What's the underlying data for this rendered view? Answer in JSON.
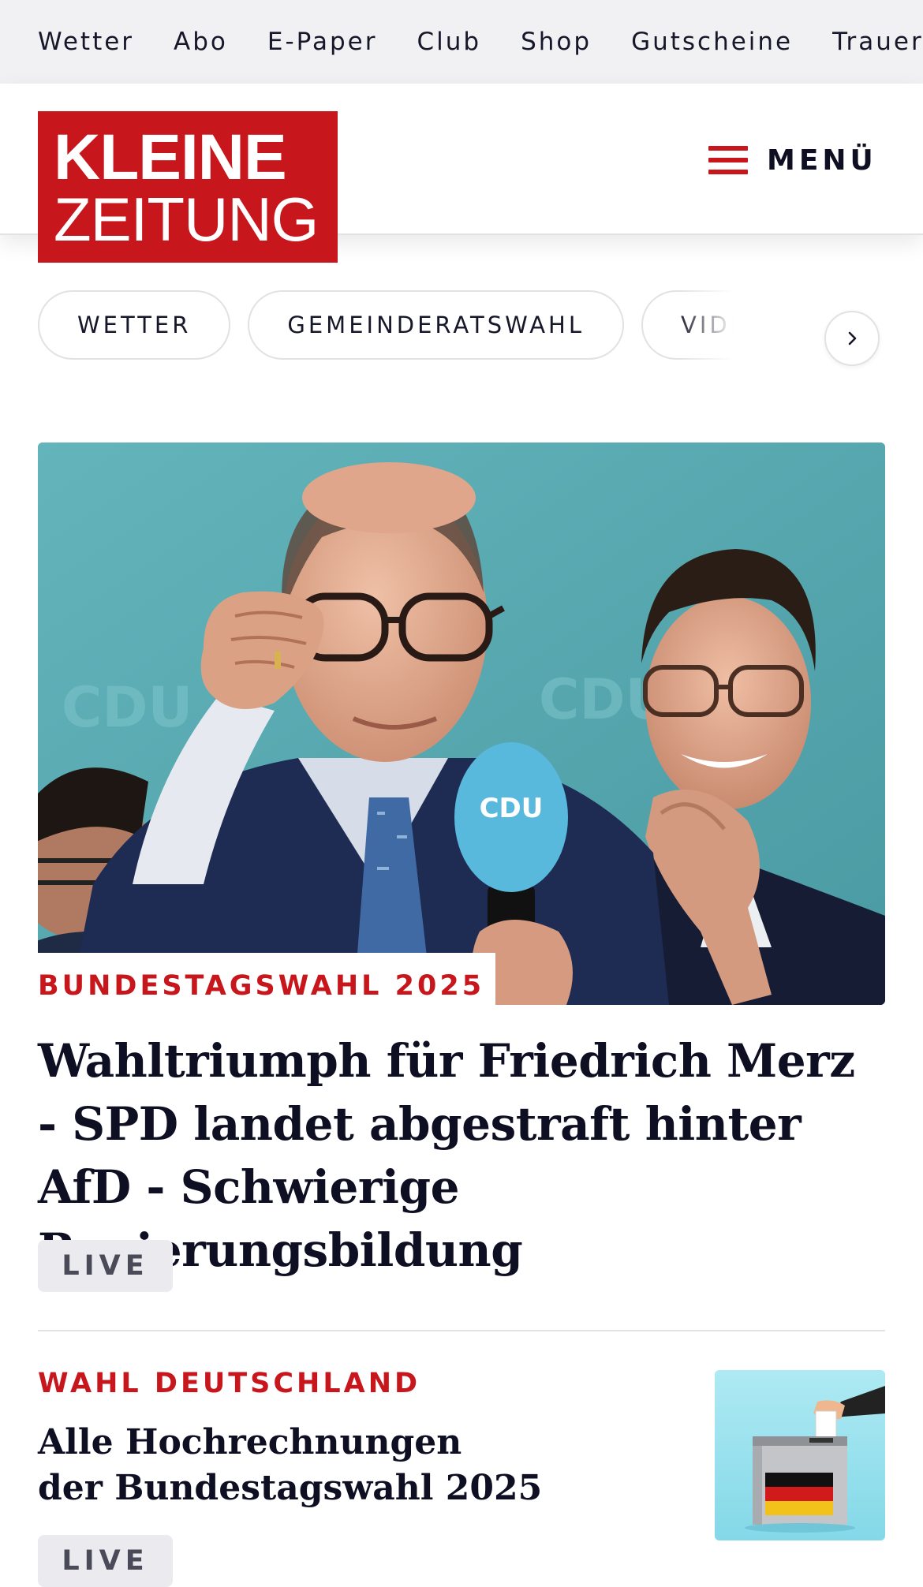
{
  "topnav": {
    "items": [
      "Wetter",
      "Abo",
      "E-Paper",
      "Club",
      "Shop",
      "Gutscheine",
      "Trauerportal"
    ]
  },
  "header": {
    "logo_line1": "KLEINE",
    "logo_line2": "ZEITUNG",
    "menu_label": "MENÜ"
  },
  "chips": {
    "items": [
      "WETTER",
      "GEMEINDERATSWAHL",
      "VIDEOS"
    ]
  },
  "lead": {
    "kicker": "BUNDESTAGSWAHL 2025",
    "headline": "Wahltriumph für Friedrich Merz - SPD landet abgestraft hinter AfD - Schwierige Regierungsbildung",
    "badge": "LIVE",
    "image_text": [
      "CDU",
      "CDU",
      "CDU"
    ]
  },
  "second": {
    "kicker": "WAHL DEUTSCHLAND",
    "headline_line1": "Alle Hochrechnungen",
    "headline_line2": "der Bundestagswahl 2025",
    "badge": "LIVE"
  },
  "colors": {
    "brand_red": "#c8161d",
    "text": "#0f0f23",
    "topnav_bg": "#f1f1f3",
    "badge_bg": "#ebebef"
  }
}
